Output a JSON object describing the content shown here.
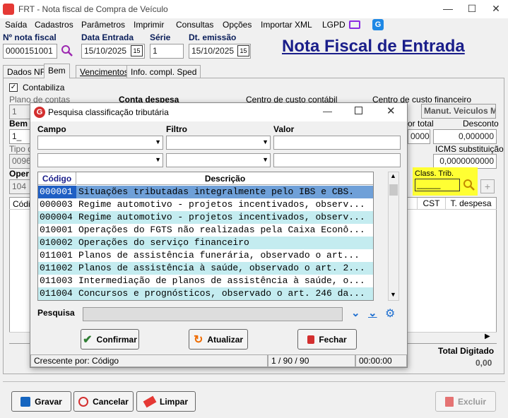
{
  "window": {
    "title": "FRT - Nota fiscal de Compra de Veículo",
    "minimize": "—",
    "maximize": "☐",
    "close": "✕"
  },
  "menu": [
    "Saída",
    "Cadastros",
    "Parâmetros",
    "Imprimir",
    "Consultas",
    "Opções",
    "Importar XML",
    "LGPD"
  ],
  "header": {
    "nota_label": "Nº nota fiscal",
    "nota_value": "0000151001",
    "data_entrada_label": "Data Entrada",
    "data_entrada_value": "15/10/2025",
    "serie_label": "Série",
    "serie_value": "1",
    "dt_emissao_label": "Dt. emissão",
    "dt_emissao_value": "15/10/2025",
    "cal_icon": "15",
    "big_title": "Nota Fiscal de Entrada"
  },
  "tabs": [
    "Dados NF",
    "Bem",
    "Vencimentos",
    "Info. compl. Sped"
  ],
  "bem": {
    "contabiliza": "Contabiliza",
    "plano_contas_label": "Plano de contas",
    "plano_contas_value": "1",
    "conta_despesa_label": "Conta despesa",
    "centro_custo_contabil_label": "Centro de custo contábil",
    "centro_custo_financeiro_label": "Centro de custo financeiro",
    "centro_custo_financeiro_value": "Manut. Veiculos M",
    "bem_label": "Bem",
    "bem_value": "1_",
    "tipo_label": "Tipo d",
    "tipo_value": "0096",
    "oper_label": "Oper",
    "oper_value": "104",
    "valor_total_label": "or total",
    "valor_total_value": "0000",
    "desconto_label": "Desconto",
    "desconto_value": "0,000000",
    "icms_subst_label": "ICMS substituição",
    "icms_subst_value": "0,0000000000",
    "class_trib_label": "Class. Trib.",
    "class_trib_value": "_____",
    "grid_col_cod": "Códi",
    "grid_col_cst": "CST",
    "grid_col_tdespesa": "T. despesa",
    "total_digitado_label": "Total Digitado",
    "total_digitado_value": "0,00"
  },
  "bottom": {
    "gravar": "Gravar",
    "cancelar": "Cancelar",
    "limpar": "Limpar",
    "excluir": "Excluir"
  },
  "dialog": {
    "title": "Pesquisa classificação tributária",
    "campo_label": "Campo",
    "filtro_label": "Filtro",
    "valor_label": "Valor",
    "col_codigo": "Código",
    "col_descricao": "Descrição",
    "rows": [
      {
        "codigo": "000001",
        "descricao": "Situações tributadas integralmente pelo IBS e CBS."
      },
      {
        "codigo": "000003",
        "descricao": "Regime automotivo - projetos incentivados, observ..."
      },
      {
        "codigo": "000004",
        "descricao": "Regime automotivo - projetos incentivados, observ..."
      },
      {
        "codigo": "010001",
        "descricao": "Operações do FGTS não realizadas pela Caixa Econô..."
      },
      {
        "codigo": "010002",
        "descricao": "Operações do serviço financeiro"
      },
      {
        "codigo": "011001",
        "descricao": "Planos de assistência funerária, observado o art..."
      },
      {
        "codigo": "011002",
        "descricao": "Planos de assistência à saúde, observado o art. 2..."
      },
      {
        "codigo": "011003",
        "descricao": "Intermediação de planos de assistência à saúde, o..."
      },
      {
        "codigo": "011004",
        "descricao": "Concursos e prognósticos, observado o art. 246 da..."
      }
    ],
    "pesquisa_label": "Pesquisa",
    "confirmar": "Confirmar",
    "atualizar": "Atualizar",
    "fechar": "Fechar",
    "status_ordem": "Crescente por: Código",
    "status_contagem": "1 / 90 / 90",
    "status_tempo": "00:00:00"
  },
  "colors": {
    "selected_row": "#6fa0d8",
    "alt_row": "#c4ecf0",
    "title_blue": "#1a1e8a",
    "label_blue": "#0a1e5a",
    "highlight": "#ffff33"
  }
}
